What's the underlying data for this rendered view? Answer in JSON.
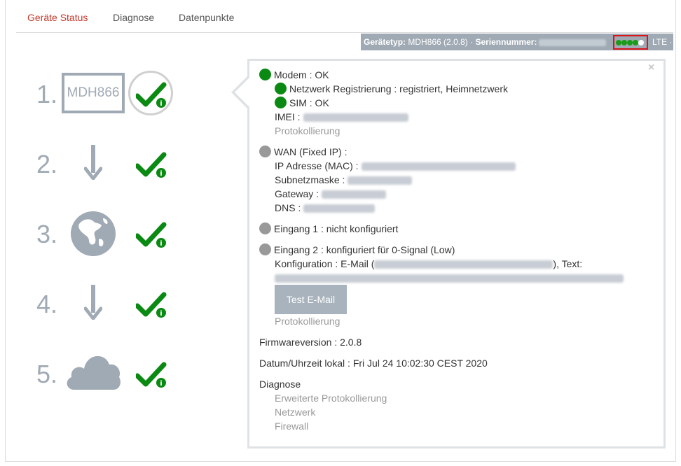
{
  "tabs": [
    {
      "label": "Geräte Status",
      "active": true
    },
    {
      "label": "Diagnose",
      "active": false
    },
    {
      "label": "Datenpunkte",
      "active": false
    }
  ],
  "infobar": {
    "type_label": "Gerätetyp:",
    "type_value": "MDH866 (2.0.8)",
    "sep": "·",
    "serial_label": "Seriennummer:",
    "signal_bars_filled": 4,
    "signal_bars_total": 5,
    "network": "LTE ·"
  },
  "steps": [
    {
      "num": "1.",
      "item": "MDH866"
    },
    {
      "num": "2."
    },
    {
      "num": "3."
    },
    {
      "num": "4."
    },
    {
      "num": "5."
    }
  ],
  "popup": {
    "close": "×",
    "modem": "Modem : OK",
    "netreg": "Netzwerk Registrierung : registriert, Heimnetzwerk",
    "sim": "SIM : OK",
    "imei_label": "IMEI :",
    "protokoll1": "Protokollierung",
    "wan": "WAN (Fixed IP) :",
    "ip_label": "IP Adresse (MAC) :",
    "subnet_label": "Subnetzmaske :",
    "gateway_label": "Gateway :",
    "dns_label": "DNS :",
    "eingang1": "Eingang 1 : nicht konfiguriert",
    "eingang2": "Eingang 2 : konfiguriert für 0-Signal (Low)",
    "konfig_prefix": "Konfiguration : E-Mail (",
    "konfig_suffix": "), Text:",
    "test_email": "Test E-Mail",
    "protokoll2": "Protokollierung",
    "firmware": "Firmwareversion : 2.0.8",
    "datetime": "Datum/Uhrzeit lokal : Fri Jul 24 10:02:30 CEST 2020",
    "diagnose": "Diagnose",
    "diag_links": [
      "Erweiterte Protokollierung",
      "Netzwerk",
      "Firewall"
    ]
  },
  "colors": {
    "accent_red": "#c0392b",
    "status_green": "#0b8a13",
    "status_gray": "#999999",
    "icon_gray": "#a0aab4",
    "check_green": "#0a8a12"
  }
}
